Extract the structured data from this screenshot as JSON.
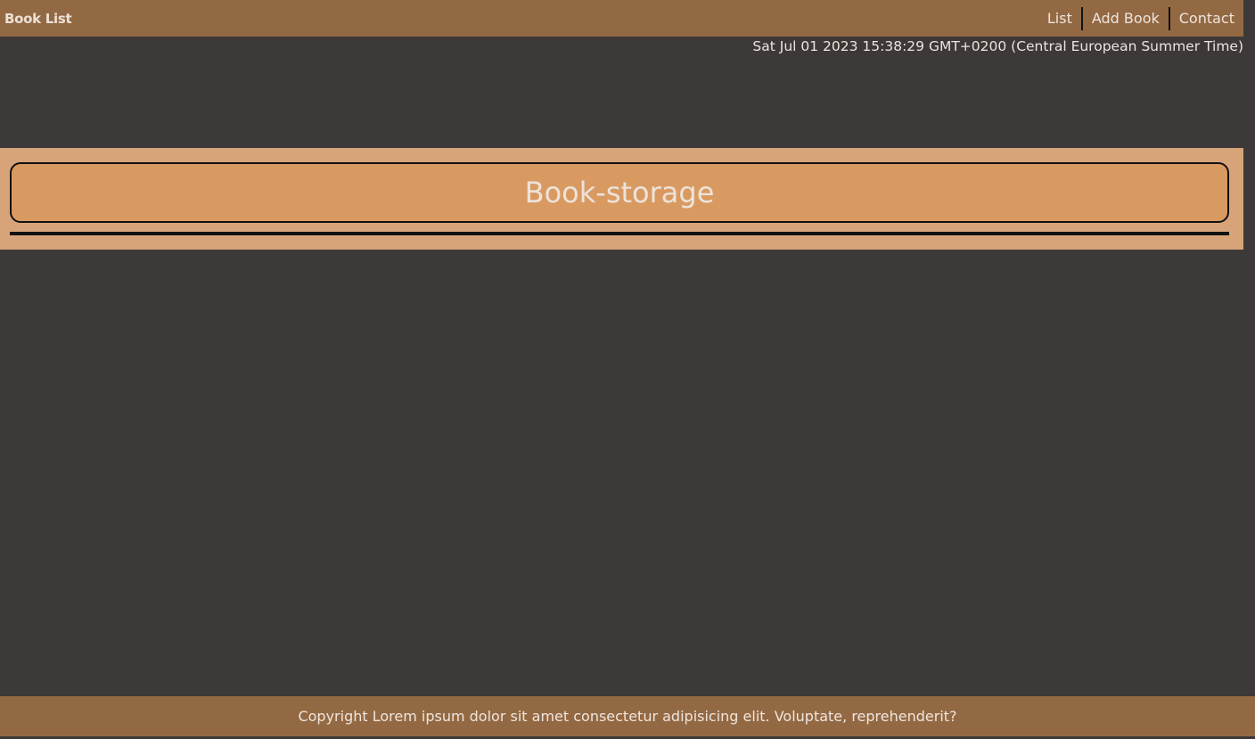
{
  "navbar": {
    "brand": "Book List",
    "links": [
      {
        "label": "List"
      },
      {
        "label": "Add Book"
      },
      {
        "label": "Contact"
      }
    ]
  },
  "datetime": "Sat Jul 01 2023 15:38:29 GMT+0200 (Central European Summer Time)",
  "hero": {
    "title": "Book-storage"
  },
  "footer": {
    "text": "Copyright Lorem ipsum dolor sit amet consectetur adipisicing elit. Voluptate, reprehenderit?"
  },
  "colors": {
    "navbar": "#936944",
    "background": "#3d3938",
    "hero_band": "#d7a47a",
    "hero_box": "#d99a62"
  }
}
